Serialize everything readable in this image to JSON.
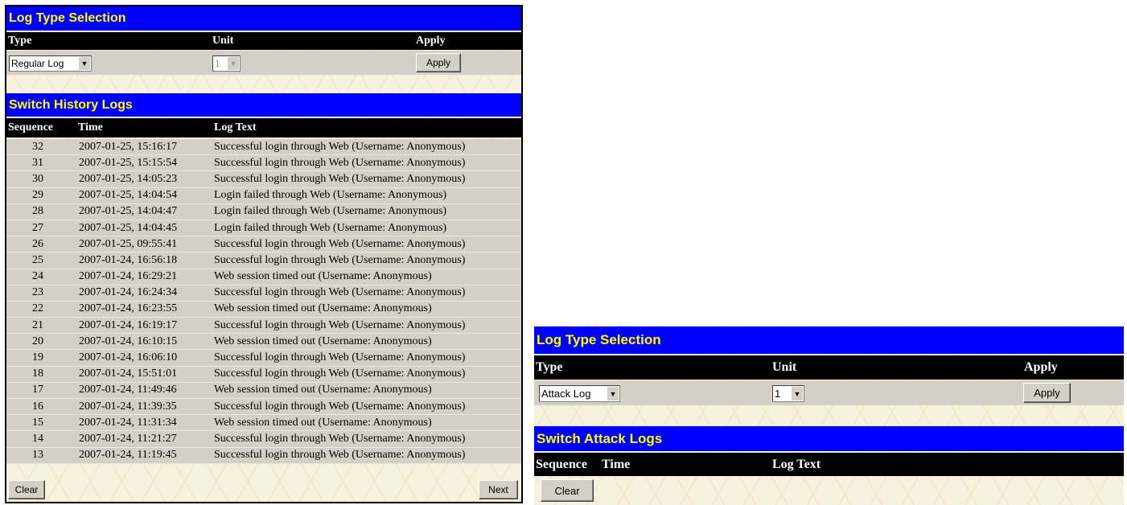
{
  "left_panel": {
    "selection_title": "Log Type Selection",
    "headers": {
      "type": "Type",
      "unit": "Unit",
      "apply": "Apply"
    },
    "type_value": "Regular Log",
    "unit_value": "1",
    "apply_label": "Apply",
    "logs_title": "Switch History Logs",
    "log_headers": {
      "sequence": "Sequence",
      "time": "Time",
      "log_text": "Log Text"
    },
    "rows": [
      {
        "seq": "32",
        "time": "2007-01-25, 15:16:17",
        "text": "Successful login through Web (Username: Anonymous)"
      },
      {
        "seq": "31",
        "time": "2007-01-25, 15:15:54",
        "text": "Successful login through Web (Username: Anonymous)"
      },
      {
        "seq": "30",
        "time": "2007-01-25, 14:05:23",
        "text": "Successful login through Web (Username: Anonymous)"
      },
      {
        "seq": "29",
        "time": "2007-01-25, 14:04:54",
        "text": "Login failed through Web (Username: Anonymous)"
      },
      {
        "seq": "28",
        "time": "2007-01-25, 14:04:47",
        "text": "Login failed through Web (Username: Anonymous)"
      },
      {
        "seq": "27",
        "time": "2007-01-25, 14:04:45",
        "text": "Login failed through Web (Username: Anonymous)"
      },
      {
        "seq": "26",
        "time": "2007-01-25, 09:55:41",
        "text": "Successful login through Web (Username: Anonymous)"
      },
      {
        "seq": "25",
        "time": "2007-01-24, 16:56:18",
        "text": "Successful login through Web (Username: Anonymous)"
      },
      {
        "seq": "24",
        "time": "2007-01-24, 16:29:21",
        "text": "Web session timed out (Username: Anonymous)"
      },
      {
        "seq": "23",
        "time": "2007-01-24, 16:24:34",
        "text": "Successful login through Web (Username: Anonymous)"
      },
      {
        "seq": "22",
        "time": "2007-01-24, 16:23:55",
        "text": "Web session timed out (Username: Anonymous)"
      },
      {
        "seq": "21",
        "time": "2007-01-24, 16:19:17",
        "text": "Successful login through Web (Username: Anonymous)"
      },
      {
        "seq": "20",
        "time": "2007-01-24, 16:10:15",
        "text": "Web session timed out (Username: Anonymous)"
      },
      {
        "seq": "19",
        "time": "2007-01-24, 16:06:10",
        "text": "Successful login through Web (Username: Anonymous)"
      },
      {
        "seq": "18",
        "time": "2007-01-24, 15:51:01",
        "text": "Successful login through Web (Username: Anonymous)"
      },
      {
        "seq": "17",
        "time": "2007-01-24, 11:49:46",
        "text": "Web session timed out (Username: Anonymous)"
      },
      {
        "seq": "16",
        "time": "2007-01-24, 11:39:35",
        "text": "Successful login through Web (Username: Anonymous)"
      },
      {
        "seq": "15",
        "time": "2007-01-24, 11:31:34",
        "text": "Web session timed out (Username: Anonymous)"
      },
      {
        "seq": "14",
        "time": "2007-01-24, 11:21:27",
        "text": "Successful login through Web (Username: Anonymous)"
      },
      {
        "seq": "13",
        "time": "2007-01-24, 11:19:45",
        "text": "Successful login through Web (Username: Anonymous)"
      }
    ],
    "clear_label": "Clear",
    "next_label": "Next"
  },
  "right_panel": {
    "selection_title": "Log Type Selection",
    "headers": {
      "type": "Type",
      "unit": "Unit",
      "apply": "Apply"
    },
    "type_value": "Attack Log",
    "unit_value": "1",
    "apply_label": "Apply",
    "logs_title": "Switch Attack Logs",
    "log_headers": {
      "sequence": "Sequence",
      "time": "Time",
      "log_text": "Log Text"
    },
    "clear_label": "Clear"
  },
  "colors": {
    "title_bar": "#0000ff",
    "title_text": "#ffff00",
    "header_bar": "#000000",
    "row_bg": "#d4d0c8",
    "panel_bg": "#f6f2dd"
  }
}
